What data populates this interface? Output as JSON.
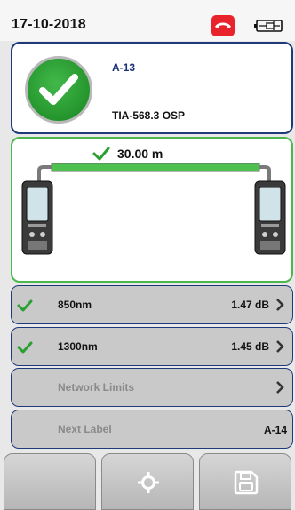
{
  "status": {
    "date": "17-10-2018",
    "icons": [
      "phone-hangup-icon",
      "battery-icon"
    ],
    "accent": "#e8232b"
  },
  "result": {
    "status_icon": "pass-check-icon",
    "label": "A-13",
    "standard": "TIA-568.3 OSP",
    "pass_color": "#2aa032"
  },
  "diagram": {
    "length": "30.00 m",
    "length_icon": "check-icon"
  },
  "measurements": [
    {
      "wavelength": "850nm",
      "loss": "1.47 dB"
    },
    {
      "wavelength": "1300nm",
      "loss": "1.45 dB"
    }
  ],
  "menu": {
    "network_limits": "Network Limits",
    "next_label_title": "Next Label",
    "next_label_value": "A-14"
  },
  "softkeys": [
    "blank-softkey",
    "locate-icon",
    "save-icon"
  ]
}
